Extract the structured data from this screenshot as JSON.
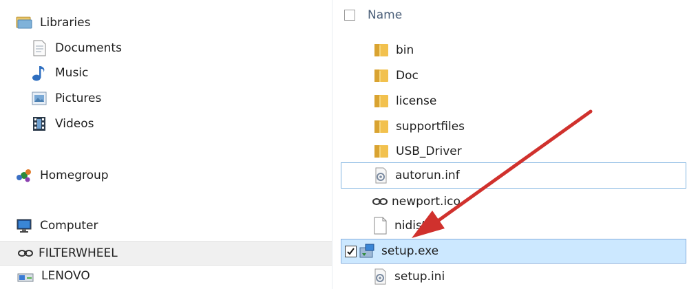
{
  "nav": {
    "libraries": {
      "label": "Libraries",
      "icon": "libraries-icon"
    },
    "library_items": [
      {
        "label": "Documents",
        "icon": "documents-icon"
      },
      {
        "label": "Music",
        "icon": "music-icon"
      },
      {
        "label": "Pictures",
        "icon": "pictures-icon"
      },
      {
        "label": "Videos",
        "icon": "videos-icon"
      }
    ],
    "homegroup": {
      "label": "Homegroup",
      "icon": "homegroup-icon"
    },
    "computer": {
      "label": "Computer",
      "icon": "computer-icon"
    },
    "drives": [
      {
        "label": "FILTERWHEEL",
        "icon": "network-drive-icon",
        "selected": true
      },
      {
        "label": "LENOVO",
        "icon": "disk-drive-icon"
      }
    ]
  },
  "file_list": {
    "column_header": "Name",
    "items": [
      {
        "name": "bin",
        "type": "folder"
      },
      {
        "name": "Doc",
        "type": "folder"
      },
      {
        "name": "license",
        "type": "folder"
      },
      {
        "name": "supportfiles",
        "type": "folder"
      },
      {
        "name": "USB_Driver",
        "type": "folder"
      },
      {
        "name": "autorun.inf",
        "type": "settings-file",
        "state": "focused"
      },
      {
        "name": "newport.ico",
        "type": "icon-file"
      },
      {
        "name": "nidist.id",
        "type": "blank-file"
      },
      {
        "name": "setup.exe",
        "type": "installer",
        "state": "selected",
        "checked": true
      },
      {
        "name": "setup.ini",
        "type": "settings-file"
      }
    ]
  },
  "annotation": {
    "arrow_color": "#d0312d"
  },
  "colors": {
    "selection": "#cce8ff",
    "selection_border": "#84acdd",
    "folder": "#f2c14e"
  }
}
